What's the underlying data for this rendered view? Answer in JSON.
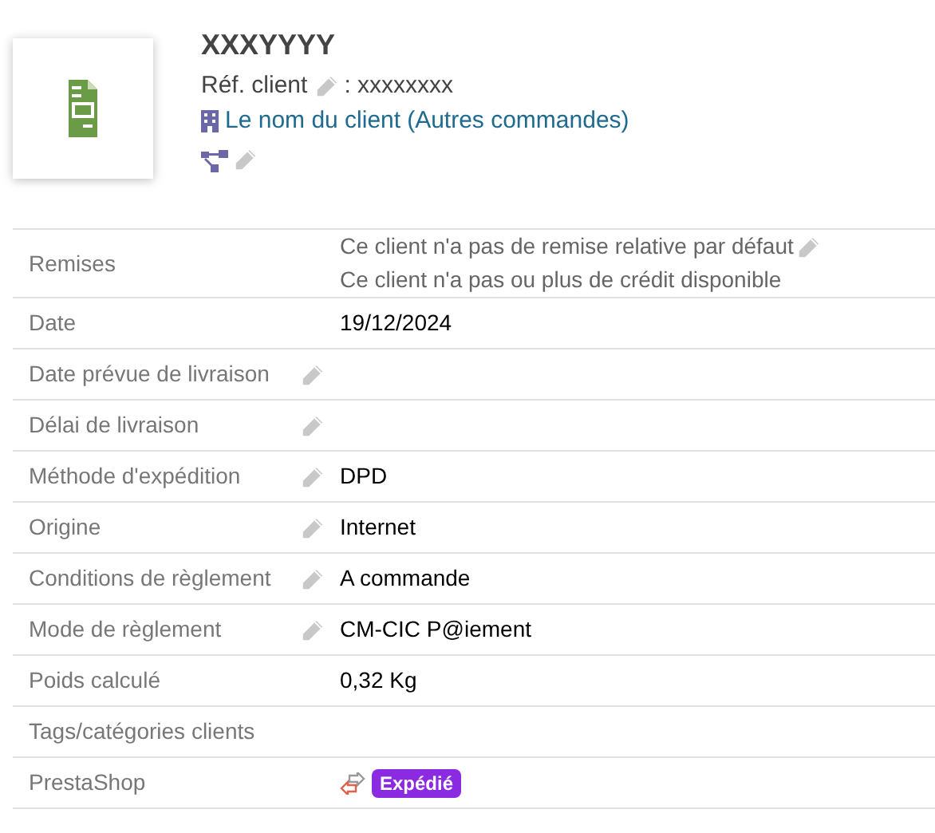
{
  "header": {
    "title": "XXXYYYY",
    "ref_label": "Réf. client",
    "ref_value": ": xxxxxxxx",
    "customer": "Le nom du client",
    "other_orders": "(Autres commandes)"
  },
  "fields": [
    {
      "kind": "notes",
      "label": "Remises",
      "editable": false,
      "lines": [
        {
          "text": "Ce client n'a pas de remise relative par défaut",
          "editable": true
        },
        {
          "text": "Ce client n'a pas ou plus de crédit disponible",
          "editable": false
        }
      ]
    },
    {
      "kind": "text",
      "label": "Date",
      "editable": false,
      "value": "19/12/2024"
    },
    {
      "kind": "text",
      "label": "Date prévue de livraison",
      "editable": true
    },
    {
      "kind": "text",
      "label": "Délai de livraison",
      "editable": true
    },
    {
      "kind": "text",
      "label": "Méthode d'expédition",
      "editable": true,
      "value": "DPD"
    },
    {
      "kind": "text",
      "label": "Origine",
      "editable": true,
      "value": "Internet"
    },
    {
      "kind": "text",
      "label": "Conditions de règlement",
      "editable": true,
      "value": "A commande"
    },
    {
      "kind": "text",
      "label": "Mode de règlement",
      "editable": true,
      "value": "CM-CIC P@iement"
    },
    {
      "kind": "text",
      "label": "Poids calculé",
      "editable": false,
      "value": "0,32 Kg"
    },
    {
      "kind": "text",
      "label": "Tags/catégories clients",
      "editable": false
    },
    {
      "kind": "status",
      "label": "PrestaShop",
      "editable": false,
      "badge": "Expédié"
    }
  ]
}
